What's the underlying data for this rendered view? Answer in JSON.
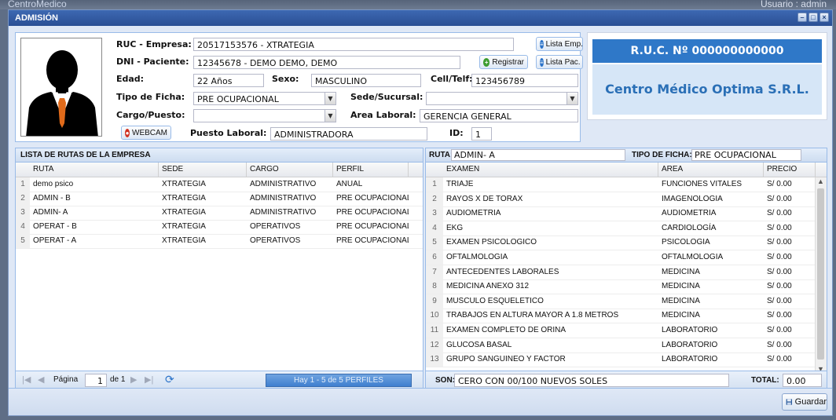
{
  "background": {
    "app_label": "CentroMedico",
    "user_label": "Usuario : admin"
  },
  "window": {
    "title": "ADMISIÓN",
    "controls": [
      "–",
      "□",
      "×"
    ]
  },
  "form": {
    "ruc_label": "RUC - Empresa:",
    "ruc_value": "20517153576 - XTRATEGIA",
    "lista_emp": "Lista Emp.",
    "dni_label": "DNI - Paciente:",
    "dni_value": "12345678 - DEMO DEMO, DEMO",
    "registrar": "Registrar",
    "lista_pac": "Lista Pac.",
    "edad_label": "Edad:",
    "edad_value": "22 Años",
    "sexo_label": "Sexo:",
    "sexo_value": "MASCULINO",
    "cell_label": "Cell/Telf:",
    "cell_value": "123456789",
    "tipo_label": "Tipo de Ficha:",
    "tipo_value": "PRE OCUPACIONAL",
    "sede_label": "Sede/Sucursal:",
    "sede_value": "",
    "cargo_label": "Cargo/Puesto:",
    "cargo_value": "",
    "area_label": "Area Laboral:",
    "area_value": "GERENCIA GENERAL",
    "webcam": "WEBCAM",
    "puesto_label": "Puesto Laboral:",
    "puesto_value": "ADMINISTRADORA",
    "id_label": "ID:",
    "id_value": "1"
  },
  "ruc_panel": {
    "ruc": "R.U.C. Nº 000000000000",
    "company": "Centro Médico Optima S.R.L."
  },
  "rutas": {
    "title": "LISTA DE RUTAS DE LA EMPRESA",
    "columns": [
      "RUTA",
      "SEDE",
      "CARGO",
      "PERFIL"
    ],
    "rows": [
      [
        "1",
        "demo psico",
        "XTRATEGIA",
        "ADMINISTRATIVO",
        "ANUAL"
      ],
      [
        "2",
        "ADMIN - B",
        "XTRATEGIA",
        "ADMINISTRATIVO",
        "PRE OCUPACIONAL"
      ],
      [
        "3",
        "ADMIN- A",
        "XTRATEGIA",
        "ADMINISTRATIVO",
        "PRE OCUPACIONAL"
      ],
      [
        "4",
        "OPERAT - B",
        "XTRATEGIA",
        "OPERATIVOS",
        "PRE OCUPACIONAL"
      ],
      [
        "5",
        "OPERAT - A",
        "XTRATEGIA",
        "OPERATIVOS",
        "PRE OCUPACIONAL"
      ]
    ],
    "pager": {
      "page_label": "Página",
      "page_value": "1",
      "of_label": "de 1",
      "status": "Hay 1 - 5 de 5 PERFILES"
    }
  },
  "examenes": {
    "ruta_label": "RUTA:",
    "ruta_value": "ADMIN- A",
    "tipo_label": "TIPO DE FICHA:",
    "tipo_value": "PRE OCUPACIONAL",
    "columns": [
      "EXAMEN",
      "AREA",
      "PRECIO"
    ],
    "rows": [
      [
        "1",
        "TRIAJE",
        "FUNCIONES VITALES",
        "S/ 0.00"
      ],
      [
        "2",
        "RAYOS X DE TORAX",
        "IMAGENOLOGIA",
        "S/ 0.00"
      ],
      [
        "3",
        "AUDIOMETRIA",
        "AUDIOMETRIA",
        "S/ 0.00"
      ],
      [
        "4",
        "EKG",
        "CARDIOLOGÍA",
        "S/ 0.00"
      ],
      [
        "5",
        "EXAMEN PSICOLOGICO",
        "PSICOLOGIA",
        "S/ 0.00"
      ],
      [
        "6",
        "OFTALMOLOGIA",
        "OFTALMOLOGIA",
        "S/ 0.00"
      ],
      [
        "7",
        "ANTECEDENTES LABORALES",
        "MEDICINA",
        "S/ 0.00"
      ],
      [
        "8",
        "MEDICINA ANEXO 312",
        "MEDICINA",
        "S/ 0.00"
      ],
      [
        "9",
        "MUSCULO ESQUELETICO",
        "MEDICINA",
        "S/ 0.00"
      ],
      [
        "10",
        "TRABAJOS EN ALTURA MAYOR A 1.8 METROS",
        "MEDICINA",
        "S/ 0.00"
      ],
      [
        "11",
        "EXAMEN COMPLETO DE ORINA",
        "LABORATORIO",
        "S/ 0.00"
      ],
      [
        "12",
        "GLUCOSA BASAL",
        "LABORATORIO",
        "S/ 0.00"
      ],
      [
        "13",
        "GRUPO SANGUINEO Y FACTOR",
        "LABORATORIO",
        "S/ 0.00"
      ]
    ],
    "son_label": "SON:",
    "son_value": "CERO CON 00/100 NUEVOS SOLES",
    "total_label": "TOTAL:",
    "total_value": "0.00"
  },
  "footer": {
    "guardar": "Guardar"
  }
}
